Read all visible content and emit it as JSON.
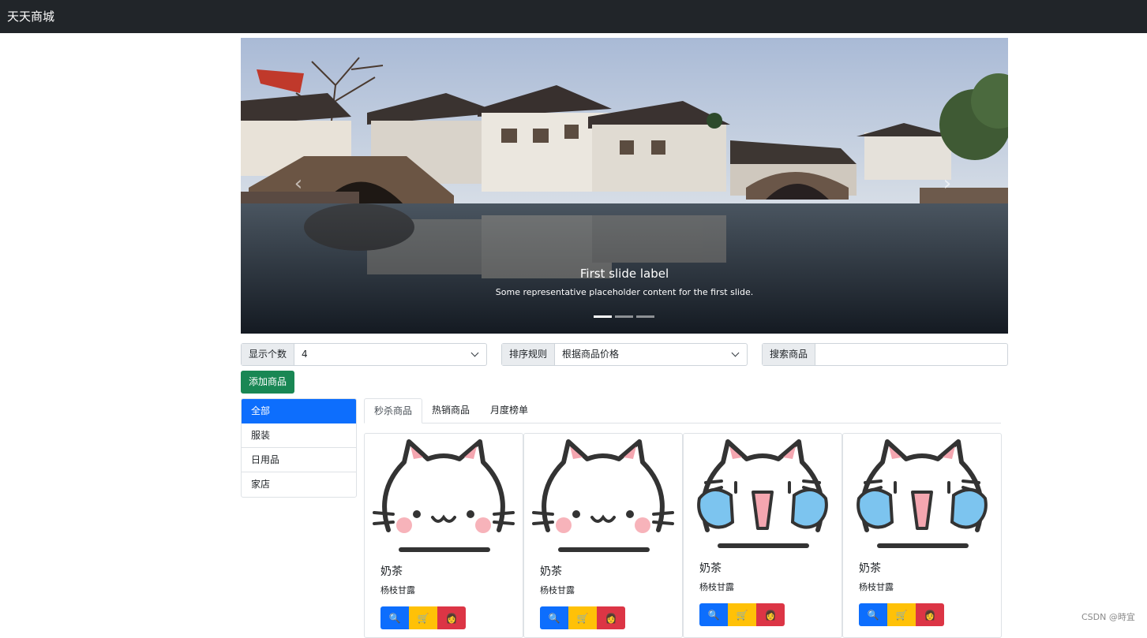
{
  "navbar": {
    "brand": "天天商城"
  },
  "carousel": {
    "caption_label": "First slide label",
    "caption_text": "Some representative placeholder content for the first slide.",
    "prev_icon": "chevron-left-icon",
    "next_icon": "chevron-right-icon",
    "indicator_count": 3,
    "active_index": 0
  },
  "controls": {
    "display_count": {
      "label": "显示个数",
      "value": "4"
    },
    "sort_rule": {
      "label": "排序规则",
      "value": "根据商品价格"
    },
    "search": {
      "label": "搜索商品",
      "value": ""
    },
    "add_button": "添加商品"
  },
  "categories": [
    {
      "label": "全部",
      "active": true
    },
    {
      "label": "服装",
      "active": false
    },
    {
      "label": "日用品",
      "active": false
    },
    {
      "label": "家店",
      "active": false
    }
  ],
  "tabs": [
    {
      "label": "秒杀商品",
      "active": true
    },
    {
      "label": "热销商品",
      "active": false
    },
    {
      "label": "月度榜单",
      "active": false
    }
  ],
  "products": [
    {
      "name": "奶茶",
      "desc": "杨枝甘露",
      "image": "smiling-cat-icon"
    },
    {
      "name": "奶茶",
      "desc": "杨枝甘露",
      "image": "smiling-cat-icon"
    },
    {
      "name": "奶茶",
      "desc": "杨枝甘露",
      "image": "crying-cat-icon"
    },
    {
      "name": "奶茶",
      "desc": "杨枝甘露",
      "image": "crying-cat-icon"
    }
  ],
  "product_buttons": {
    "view": {
      "icon": "magnifier-icon",
      "glyph": "🔍"
    },
    "cart": {
      "icon": "cart-icon",
      "glyph": "🛒"
    },
    "user": {
      "icon": "user-icon",
      "glyph": "👩"
    }
  },
  "colors": {
    "navbar": "#212529",
    "primary": "#0d6efd",
    "success": "#198754",
    "warning": "#ffc107",
    "danger": "#dc3545"
  },
  "watermark": "CSDN @時宜"
}
